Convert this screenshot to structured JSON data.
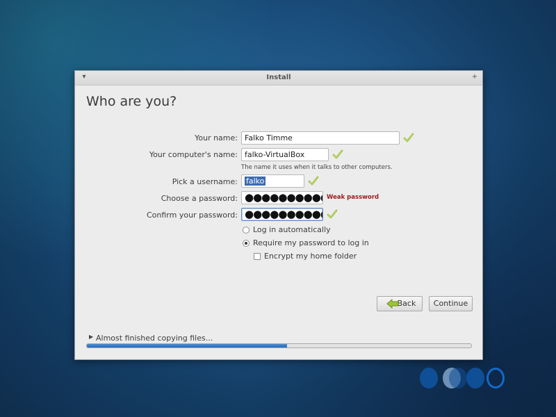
{
  "window": {
    "title": "Install",
    "menu_icon": "chevron-down-icon",
    "maximize_icon": "plus-icon"
  },
  "page": {
    "heading": "Who are you?"
  },
  "form": {
    "name_label": "Your name:",
    "name_value": "Falko Timme",
    "computer_label": "Your computer's name:",
    "computer_value": "falko-VirtualBox",
    "computer_hint": "The name it uses when it talks to other computers.",
    "username_label": "Pick a username:",
    "username_value": "falko",
    "password_label": "Choose a password:",
    "password_value": "●●●●●●●●●●",
    "password_strength": "Weak password",
    "confirm_label": "Confirm your password:",
    "confirm_value": "●●●●●●●●●●"
  },
  "options": {
    "login_auto_label": "Log in automatically",
    "login_auto_selected": false,
    "require_password_label": "Require my password to log in",
    "require_password_selected": true,
    "encrypt_label": "Encrypt my home folder",
    "encrypt_checked": false
  },
  "buttons": {
    "back_label": "Back",
    "continue_label": "Continue"
  },
  "progress": {
    "status_text": "Almost finished copying files...",
    "fraction": 0.52
  },
  "colors": {
    "valid_check": "#8fb52a",
    "weak_password": "#9b1b1b",
    "progress_fill": "#2f73c4",
    "orb_blue": "#0f5aa8"
  }
}
